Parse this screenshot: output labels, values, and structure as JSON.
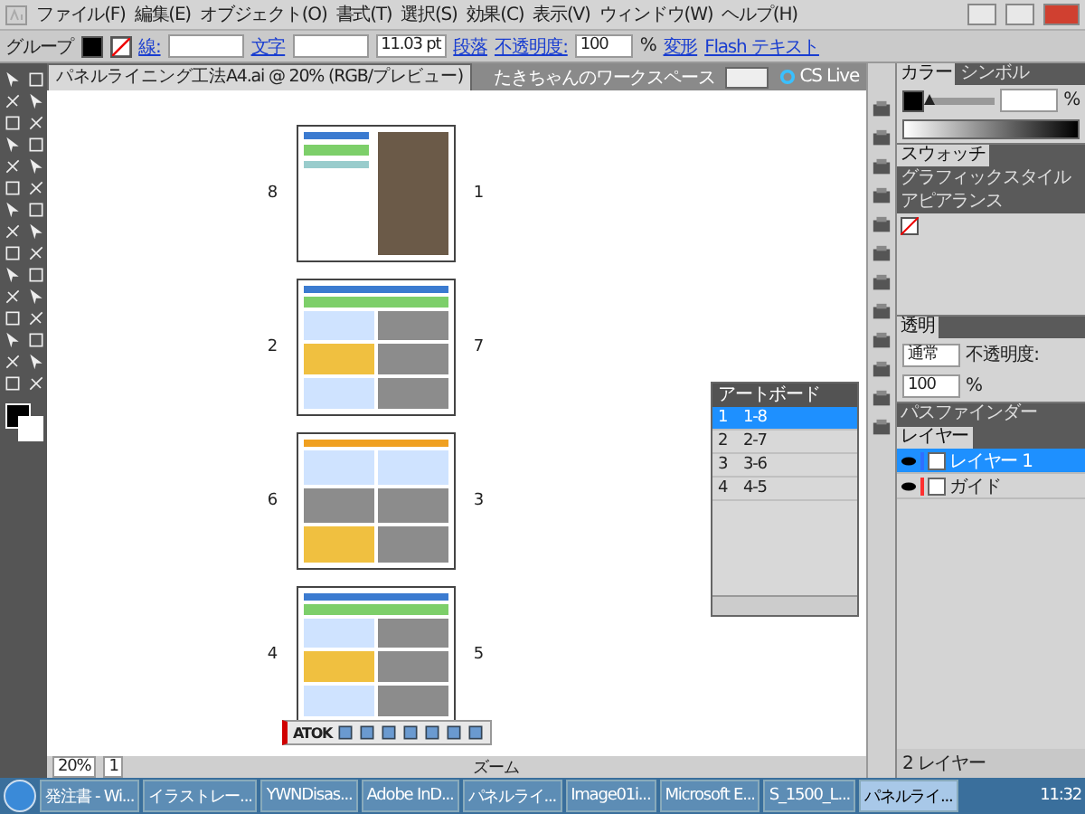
{
  "menu_bar": {
    "items": [
      "ファイル(F)",
      "編集(E)",
      "オブジェクト(O)",
      "書式(T)",
      "選択(S)",
      "効果(C)",
      "表示(V)",
      "ウィンドウ(W)",
      "ヘルプ(H)"
    ]
  },
  "control_bar": {
    "selection": "グループ",
    "stroke_label": "線:",
    "character_link": "文字",
    "font_size": "11.03 pt",
    "paragraph_link": "段落",
    "opacity_label": "不透明度:",
    "opacity": "100",
    "opacity_unit": "%",
    "transform_link": "変形",
    "flash_text_link": "Flash テキスト"
  },
  "document_tab": {
    "title": "パネルライニング工法A4.ai @ 20% (RGB/プレビュー)"
  },
  "workspace": {
    "name": "たきちゃんのワークスペース",
    "cs_live": "CS Live"
  },
  "artboards": [
    {
      "kind": "cover",
      "left_number": "8",
      "right_number": "1"
    },
    {
      "kind": "photos",
      "left_number": "2",
      "right_number": "7"
    },
    {
      "kind": "tables",
      "left_number": "6",
      "right_number": "3"
    },
    {
      "kind": "photos",
      "left_number": "4",
      "right_number": "5"
    }
  ],
  "artboard_panel": {
    "title": "アートボード",
    "rows": [
      {
        "number": "1",
        "name": "1-8",
        "selected": true
      },
      {
        "number": "2",
        "name": "2-7",
        "selected": false
      },
      {
        "number": "3",
        "name": "3-6",
        "selected": false
      },
      {
        "number": "4",
        "name": "4-5",
        "selected": false
      }
    ]
  },
  "color_panel": {
    "tabs": [
      {
        "label": "カラー",
        "selected": true
      },
      {
        "label": "シンボル",
        "selected": false
      }
    ],
    "unit": "%",
    "level": 0
  },
  "swatch_panel": {
    "tabs": [
      {
        "label": "スウォッチ",
        "selected": true
      },
      {
        "label": "グラフィックスタイル",
        "selected": false
      },
      {
        "label": "アピアランス",
        "selected": false
      }
    ]
  },
  "transparency_panel": {
    "title": "透明",
    "blend_mode": "通常",
    "opacity_label": "不透明度:",
    "opacity": "100",
    "opacity_unit": "%"
  },
  "layers_panel": {
    "tabs": [
      {
        "label": "パスファインダー",
        "selected": false
      },
      {
        "label": "レイヤー",
        "selected": true
      }
    ],
    "layers": [
      {
        "name": "レイヤー 1",
        "color": "#2f6fff",
        "selected": true,
        "visible": true
      },
      {
        "name": "ガイド",
        "color": "#ff3030",
        "selected": false,
        "visible": true
      }
    ],
    "footer": "2 レイヤー"
  },
  "ime_bar": {
    "label": "ATOK"
  },
  "status_bar": {
    "zoom": "20%",
    "page": "1",
    "tool": "ズーム"
  },
  "taskbar": {
    "items": [
      {
        "label": "発注書 - Wi...",
        "selected": false
      },
      {
        "label": "イラストレー...",
        "selected": false
      },
      {
        "label": "YWNDisas...",
        "selected": false
      },
      {
        "label": "Adobe InD...",
        "selected": false
      },
      {
        "label": "パネルライ...",
        "selected": false
      },
      {
        "label": "Image01i...",
        "selected": false
      },
      {
        "label": "Microsoft E...",
        "selected": false
      },
      {
        "label": "S_1500_L...",
        "selected": false
      },
      {
        "label": "パネルライ...",
        "selected": true
      }
    ],
    "clock": "11:32"
  }
}
